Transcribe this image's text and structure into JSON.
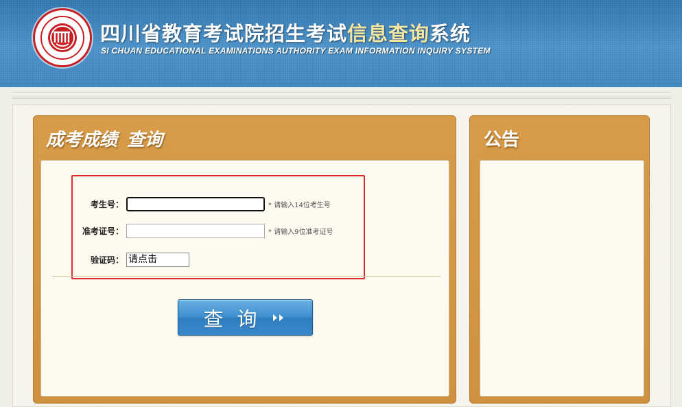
{
  "header": {
    "title_part1": "四川省教育考试院招生考试",
    "title_highlight": "信息查询",
    "title_part2": "系统",
    "title_en": "SI CHUAN EDUCATIONAL EXAMINATIONS AUTHORITY EXAM INFORMATION INQUIRY SYSTEM",
    "logo_icon": "sceea-seal-logo"
  },
  "query_panel": {
    "title_part1": "成考成绩",
    "title_part2": "查询",
    "fields": {
      "exam_no": {
        "label": "考生号：",
        "value": "",
        "hint": "* 请输入14位考生号"
      },
      "admission_no": {
        "label": "准考证号：",
        "value": "",
        "hint": "* 请输入9位准考证号"
      },
      "captcha": {
        "label": "验证码：",
        "value": "请点击"
      }
    },
    "submit_label": "查询",
    "submit_icon": "double-chevron-right-icon"
  },
  "notice_panel": {
    "title": "公告"
  },
  "colors": {
    "header_blue": "#3d83bd",
    "title_highlight": "#f3e6a2",
    "panel_orange": "#d4963f",
    "form_border_red": "#e0292c",
    "button_blue": "#3a88c9"
  }
}
